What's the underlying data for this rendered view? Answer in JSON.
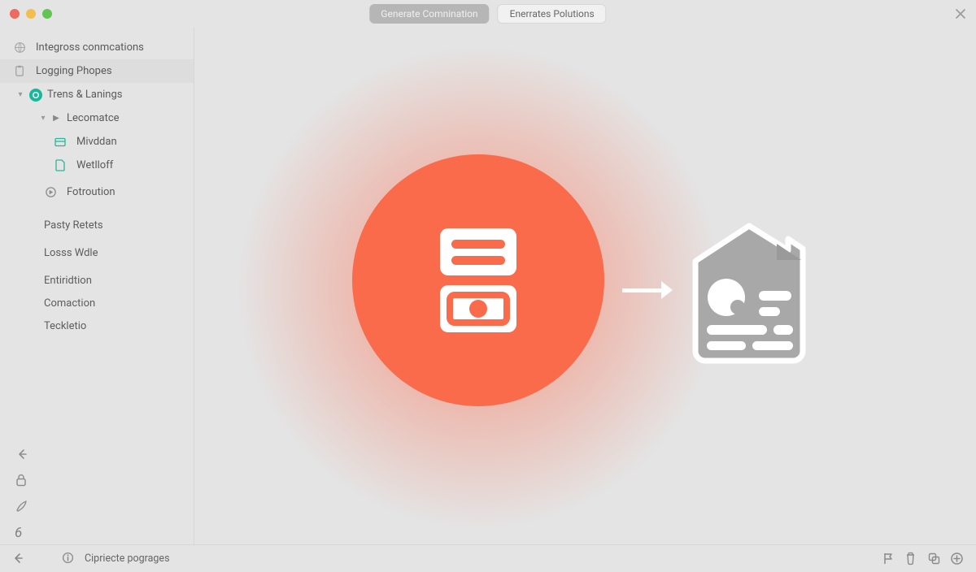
{
  "header": {
    "generate_label": "Generate Comnination",
    "enerrates_label": "Enerrates Polutions"
  },
  "sidebar": {
    "items": [
      {
        "label": "Integross conmcations"
      },
      {
        "label": "Logging Phopes"
      },
      {
        "label": "Trens & Lanings"
      },
      {
        "label": "Lecomatce"
      },
      {
        "label": "Mivddan"
      },
      {
        "label": "Wetlloff"
      },
      {
        "label": "Fotroution"
      }
    ],
    "groups": [
      {
        "label": "Pasty Retets"
      },
      {
        "label": "Losss Wdle"
      },
      {
        "label": "Entiridtion"
      },
      {
        "label": "Comaction"
      },
      {
        "label": "Teckletio"
      }
    ],
    "bottom_number": "6"
  },
  "statusbar": {
    "text": "Cipriecte pograges"
  }
}
